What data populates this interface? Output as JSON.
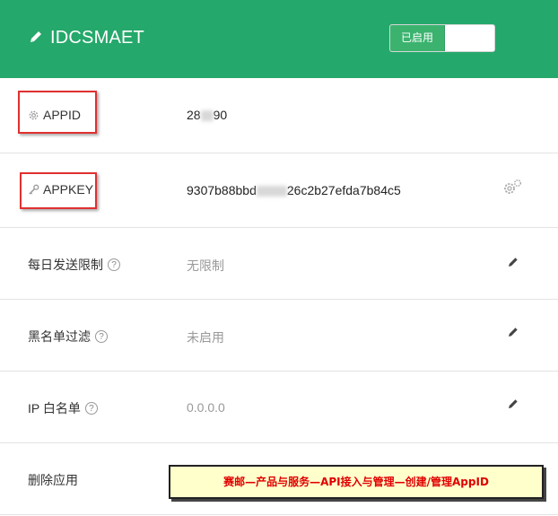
{
  "header": {
    "title": "IDCSMAET",
    "toggle_label": "已启用",
    "bg_color": "#25a86b"
  },
  "rows": {
    "appid": {
      "label": "APPID",
      "value_prefix": "28",
      "value_suffix": "90",
      "icon": "gear-icon"
    },
    "appkey": {
      "label": "APPKEY",
      "value_prefix": "9307b88bbd",
      "value_suffix": "26c2b27efda7b84c5",
      "icon": "key-icon",
      "action_icon": "gears-icon"
    },
    "daily_limit": {
      "label": "每日发送限制",
      "value": "无限制"
    },
    "blacklist": {
      "label": "黑名单过滤",
      "value": "未启用"
    },
    "ip_whitelist": {
      "label": "IP 白名单",
      "value": "0.0.0.0"
    },
    "delete_app": {
      "label": "删除应用"
    }
  },
  "help_glyph": "?",
  "annotation": {
    "text": "赛邮—产品与服务—API接入与管理—创建/管理AppID"
  }
}
